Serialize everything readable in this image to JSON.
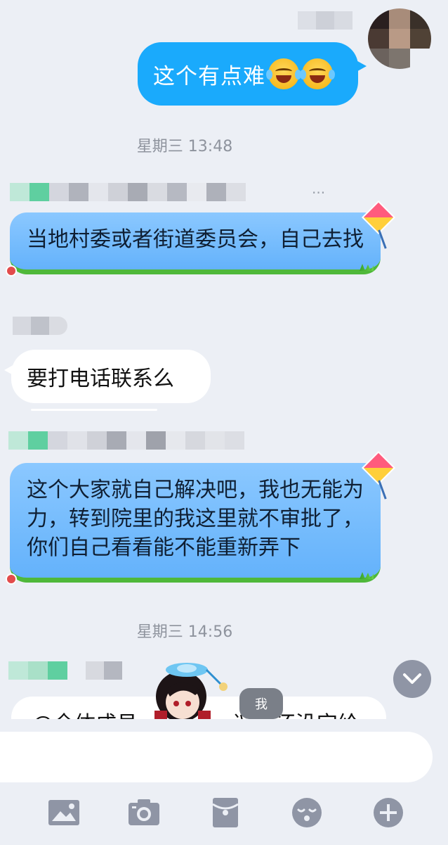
{
  "messages": {
    "self_message": "这个有点难",
    "timestamp_1": "星期三 13:48",
    "kite_message_1": "当地村委或者街道委员会，自己去找",
    "white_message": "要打电话联系么",
    "kite_message_2": "这个大家就自己解决吧，我也无能为力，转到院里的我这里就不审批了，你们自己看看能不能重新弄下",
    "timestamp_2": "星期三 14:56",
    "partial_message": "@全体成员",
    "partial_message_tail": "议书还没完给"
  },
  "overlay": {
    "me_badge": "我"
  },
  "input": {
    "value": "",
    "placeholder": ""
  },
  "icons": {
    "more": "ellipsis-icon",
    "scroll": "chevron-down-icon",
    "toolbar": [
      "image-icon",
      "camera-icon",
      "red-packet-icon",
      "emoji-icon",
      "plus-icon"
    ]
  },
  "colors": {
    "background": "#eceff5",
    "self_bubble": "#1aaafc",
    "kite_bubble": "#64b2fb",
    "grass": "#4fb83a",
    "icon_gray": "#8f95a5"
  }
}
